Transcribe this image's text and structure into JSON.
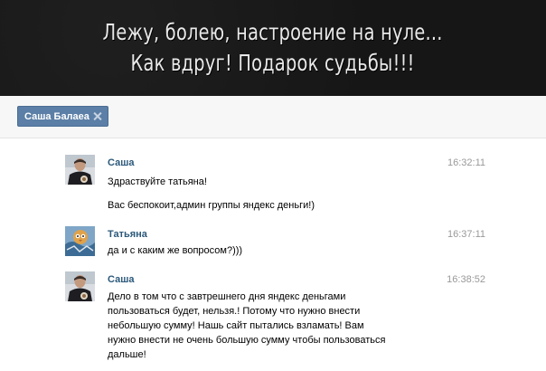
{
  "banner": {
    "line1": "Лежу, болею, настроение на нуле...",
    "line2": "Как вдруг! Подарок судьбы!!!"
  },
  "tab": {
    "label": "Саша Балаеа"
  },
  "messages": [
    {
      "author": "Саша",
      "time": "16:32:11",
      "lines": [
        "Здраствуйте татьяна!",
        "Вас беспокоит,админ группы яндекс деньги!)"
      ]
    },
    {
      "author": "Татьяна",
      "time": "16:37:11",
      "lines": [
        "да и с каким же вопросом?)))"
      ]
    },
    {
      "author": "Саша",
      "time": "16:38:52",
      "lines": [
        "Дело в том что с завтрешнего дня яндекс деньгами",
        "пользоваться будет, нельзя.! Потому что нужно внести",
        "небольшую сумму! Нашь сайт пытались взламать! Вам",
        "нужно внести не очень большую сумму чтобы пользоваться",
        "дальше!"
      ]
    }
  ],
  "colors": {
    "author": "#2b587a",
    "tab_bg": "#5b7fa6",
    "banner_bg": "#161616"
  },
  "icons": {
    "tab_close": "close-icon"
  }
}
